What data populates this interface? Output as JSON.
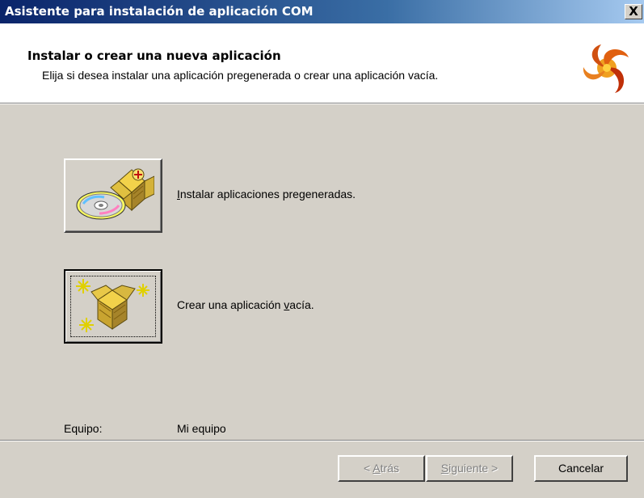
{
  "window": {
    "title": "Asistente para instalación de aplicación COM",
    "close_label": "X"
  },
  "header": {
    "title": "Instalar o crear una nueva aplicación",
    "subtitle": "Elija si desea instalar una aplicación pregenerada o crear una aplicación vacía.",
    "logo_icon": "com-wizard-swirl-icon"
  },
  "options": {
    "install": {
      "icon": "cd-package-icon",
      "label_prefix": "",
      "label_accel": "I",
      "label_rest": "nstalar aplicaciones pregeneradas."
    },
    "create": {
      "icon": "new-package-sparkle-icon",
      "label_prefix": "Crear una aplicación ",
      "label_accel": "v",
      "label_rest": "acía."
    }
  },
  "computer": {
    "label": "Equipo:",
    "value": "Mi equipo"
  },
  "footer": {
    "back_prefix": "< ",
    "back_accel": "A",
    "back_rest": "trás",
    "next_accel": "S",
    "next_rest": "iguiente >",
    "cancel_label": "Cancelar"
  },
  "colors": {
    "titlebar_start": "#0a246a",
    "titlebar_end": "#a6caf0",
    "dialog_face": "#d4d0c8",
    "header_bg": "#ffffff",
    "disabled_text": "#808080"
  }
}
